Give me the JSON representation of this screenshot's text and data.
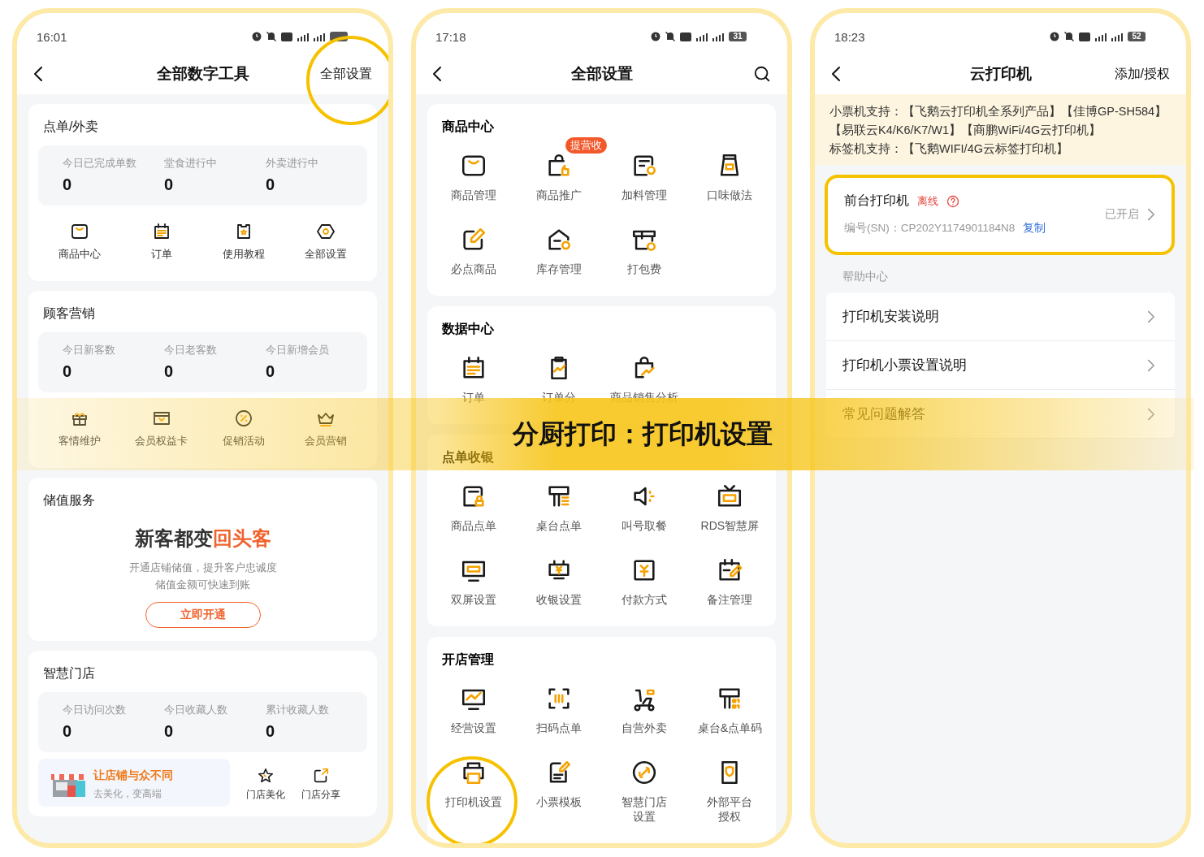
{
  "banner": {
    "title": "分厨打印：打印机设置"
  },
  "left_screen": {
    "status_bar": {
      "time": "16:01"
    },
    "header": {
      "title": "全部数字工具",
      "action": "全部设置"
    },
    "sections": [
      {
        "title": "点单/外卖",
        "kind": "stats",
        "stats": [
          {
            "label": "今日已完成单数",
            "value": "0"
          },
          {
            "label": "堂食进行中",
            "value": "0"
          },
          {
            "label": "外卖进行中",
            "value": "0"
          }
        ],
        "tools": [
          {
            "label": "商品中心"
          },
          {
            "label": "订单"
          },
          {
            "label": "使用教程"
          },
          {
            "label": "全部设置"
          }
        ]
      },
      {
        "title": "顾客营销",
        "kind": "stats",
        "stats": [
          {
            "label": "今日新客数",
            "value": "0"
          },
          {
            "label": "今日老客数",
            "value": "0"
          },
          {
            "label": "今日新增会员",
            "value": "0"
          }
        ],
        "tools": [
          {
            "label": "客情维护"
          },
          {
            "label": "会员权益卡"
          },
          {
            "label": "促销活动"
          },
          {
            "label": "会员营销"
          }
        ]
      },
      {
        "title": "储值服务",
        "kind": "promo",
        "headline": "新客都变",
        "headline_highlight": "回头客",
        "lines": [
          "开通店铺储值，提升客户忠诚度",
          "储值金额可快速到账"
        ],
        "button": "立即开通"
      },
      {
        "title": "智慧门店",
        "kind": "stats",
        "stats": [
          {
            "label": "今日访问次数",
            "value": "0"
          },
          {
            "label": "今日收藏人数",
            "value": "0"
          },
          {
            "label": "累计收藏人数",
            "value": "0"
          }
        ],
        "promo_tile": {
          "title": "让店铺与众不同",
          "subtitle": "去美化，变高端"
        },
        "tools": [
          {
            "label": "门店美化"
          },
          {
            "label": "门店分享"
          }
        ]
      }
    ]
  },
  "middle_screen": {
    "status_bar": {
      "time": "17:18",
      "battery": "31"
    },
    "header": {
      "title": "全部设置"
    },
    "sections": [
      {
        "title": "商品中心",
        "items": [
          {
            "label": "商品管理"
          },
          {
            "label": "商品推广",
            "badge": "提营收"
          },
          {
            "label": "加料管理"
          },
          {
            "label": "口味做法"
          },
          {
            "label": "必点商品"
          },
          {
            "label": "库存管理"
          },
          {
            "label": "打包费"
          }
        ]
      },
      {
        "title": "数据中心",
        "items": [
          {
            "label": "订单"
          },
          {
            "label": "订单分"
          },
          {
            "label": "商品销售分析"
          }
        ]
      },
      {
        "title": "点单收银",
        "items": [
          {
            "label": "商品点单"
          },
          {
            "label": "桌台点单"
          },
          {
            "label": "叫号取餐"
          },
          {
            "label": "RDS智慧屏"
          },
          {
            "label": "双屏设置"
          },
          {
            "label": "收银设置"
          },
          {
            "label": "付款方式"
          },
          {
            "label": "备注管理"
          }
        ]
      },
      {
        "title": "开店管理",
        "items": [
          {
            "label": "经营设置"
          },
          {
            "label": "扫码点单"
          },
          {
            "label": "自营外卖"
          },
          {
            "label": "桌台&点单码"
          },
          {
            "label": "打印机设置"
          },
          {
            "label": "小票模板"
          },
          {
            "lines": [
              "智慧门店",
              "设置"
            ]
          },
          {
            "lines": [
              "外部平台",
              "授权"
            ]
          }
        ]
      }
    ]
  },
  "right_screen": {
    "status_bar": {
      "time": "18:23",
      "battery": "52"
    },
    "header": {
      "title": "云打印机",
      "action": "添加/授权"
    },
    "notice": [
      "小票机支持：【飞鹅云打印机全系列产品】【佳博GP-SH584】【易联云K4/K6/K7/W1】【商鹏WiFi/4G云打印机】",
      "标签机支持：【飞鹅WIFI/4G云标签打印机】"
    ],
    "printer": {
      "name": "前台打印机",
      "status": "离线",
      "sn": "编号(SN)：CP202Y1174901184N8",
      "copy": "复制",
      "state": "已开启"
    },
    "help_title": "帮助中心",
    "help_items": [
      {
        "label": "打印机安装说明"
      },
      {
        "label": "打印机小票设置说明"
      },
      {
        "label": "常见问题解答"
      }
    ]
  }
}
